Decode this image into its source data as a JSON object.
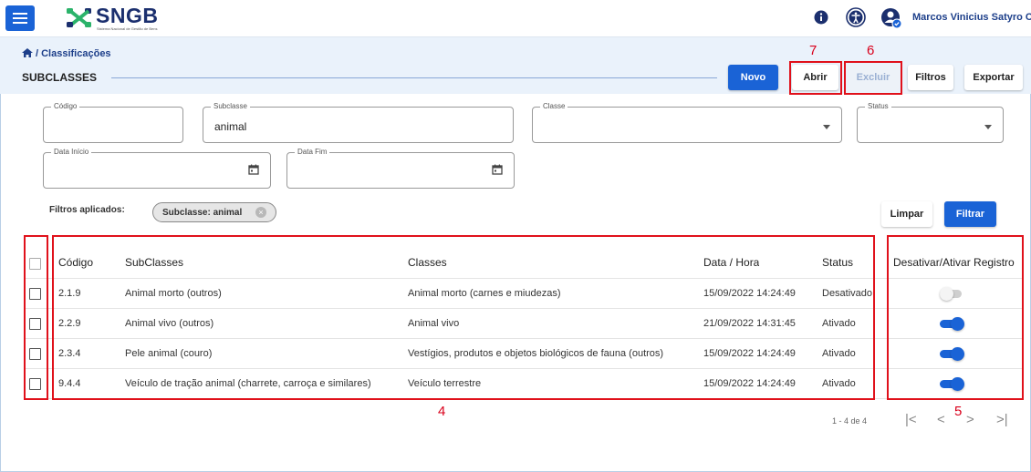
{
  "app": {
    "logo_text": "SNGB",
    "logo_subtitle": "Sistema Nacional de Gestão de Bens",
    "user_name": "Marcos Vinicius Satyro C..."
  },
  "breadcrumb": {
    "text": "/ Classificações"
  },
  "page": {
    "title": "SUBCLASSES"
  },
  "toolbar": {
    "novo": "Novo",
    "abrir": "Abrir",
    "excluir": "Excluir",
    "filtros": "Filtros",
    "exportar": "Exportar"
  },
  "filters": {
    "codigo": {
      "label": "Código",
      "value": ""
    },
    "subclasse": {
      "label": "Subclasse",
      "value": "animal"
    },
    "classe": {
      "label": "Classe",
      "value": ""
    },
    "status": {
      "label": "Status",
      "value": ""
    },
    "data_inicio": {
      "label": "Data Início",
      "value": ""
    },
    "data_fim": {
      "label": "Data Fim",
      "value": ""
    },
    "applied_label": "Filtros aplicados:",
    "chip": "Subclasse: animal",
    "limpar": "Limpar",
    "filtrar": "Filtrar"
  },
  "table": {
    "headers": [
      "Código",
      "SubClasses",
      "Classes",
      "Data / Hora",
      "Status",
      "Desativar/Ativar Registro"
    ],
    "rows": [
      {
        "codigo": "2.1.9",
        "subclasse": "Animal morto (outros)",
        "classe": "Animal morto (carnes e miudezas)",
        "data": "15/09/2022 14:24:49",
        "status": "Desativado",
        "active": false
      },
      {
        "codigo": "2.2.9",
        "subclasse": "Animal vivo (outros)",
        "classe": "Animal vivo",
        "data": "21/09/2022 14:31:45",
        "status": "Ativado",
        "active": true
      },
      {
        "codigo": "2.3.4",
        "subclasse": "Pele animal (couro)",
        "classe": "Vestígios, produtos e objetos biológicos de fauna (outros)",
        "data": "15/09/2022 14:24:49",
        "status": "Ativado",
        "active": true
      },
      {
        "codigo": "9.4.4",
        "subclasse": "Veículo de tração animal (charrete, carroça e similares)",
        "classe": "Veículo terrestre",
        "data": "15/09/2022 14:24:49",
        "status": "Ativado",
        "active": true
      }
    ]
  },
  "pagination": {
    "range": "1 - 4 de 4",
    "first": "|<",
    "prev": "<",
    "next": ">",
    "last": ">|"
  },
  "annotations": {
    "n7": "7",
    "n6": "6",
    "n4": "4",
    "n5": "5"
  },
  "colors": {
    "primary": "#1a63d6",
    "highlight": "#e0111b",
    "toggle_on": "#1a63d6",
    "toggle_off": "#cfcfcf"
  }
}
